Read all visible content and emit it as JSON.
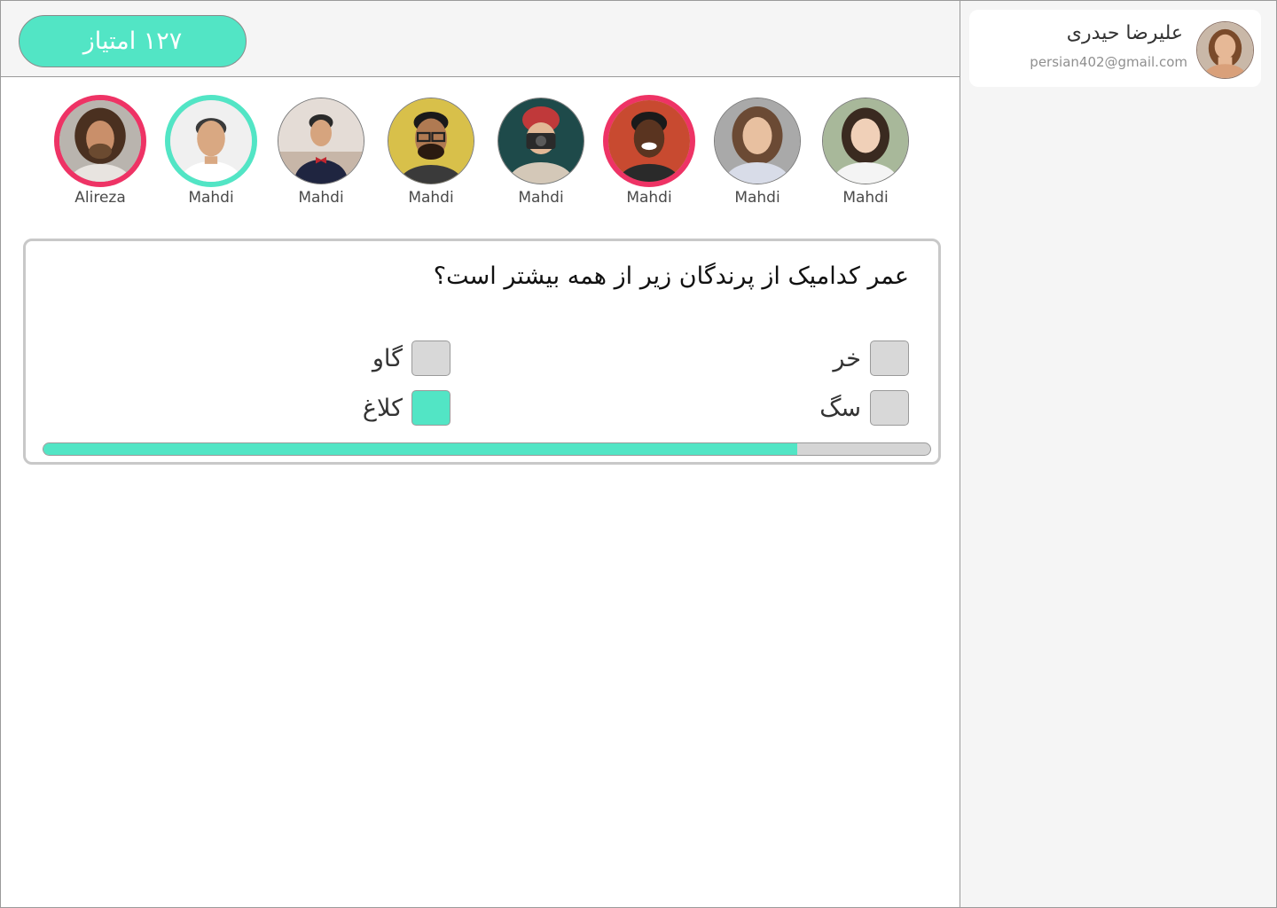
{
  "header": {
    "score_label": "۱۲۷ امتیاز"
  },
  "profile": {
    "name": "علیرضا حیدری",
    "email": "persian402@gmail.com",
    "avatar": "woman-portrait"
  },
  "players": [
    {
      "name": "Alireza",
      "ring": "red",
      "avatar": "man-dreadlocks-portrait"
    },
    {
      "name": "Mahdi",
      "ring": "green",
      "avatar": "man-smiling-portrait"
    },
    {
      "name": "Mahdi",
      "ring": "none",
      "avatar": "man-bowtie-portrait"
    },
    {
      "name": "Mahdi",
      "ring": "none",
      "avatar": "man-glasses-portrait"
    },
    {
      "name": "Mahdi",
      "ring": "none",
      "avatar": "woman-camera-portrait"
    },
    {
      "name": "Mahdi",
      "ring": "red",
      "avatar": "man-laughing-portrait"
    },
    {
      "name": "Mahdi",
      "ring": "none",
      "avatar": "woman-portrait"
    },
    {
      "name": "Mahdi",
      "ring": "none",
      "avatar": "woman-asian-portrait"
    }
  ],
  "question": {
    "text": "عمر کدامیک از پرندگان زیر از همه بیشتر است؟",
    "options": [
      {
        "label": "خر",
        "checked": false
      },
      {
        "label": "گاو",
        "checked": false
      },
      {
        "label": "سگ",
        "checked": false
      },
      {
        "label": "کلاغ",
        "checked": true
      }
    ],
    "progress": 0.85
  },
  "colors": {
    "accent": "#52e5c5",
    "ring_red": "#ee3365",
    "panel": "#f5f5f5"
  }
}
